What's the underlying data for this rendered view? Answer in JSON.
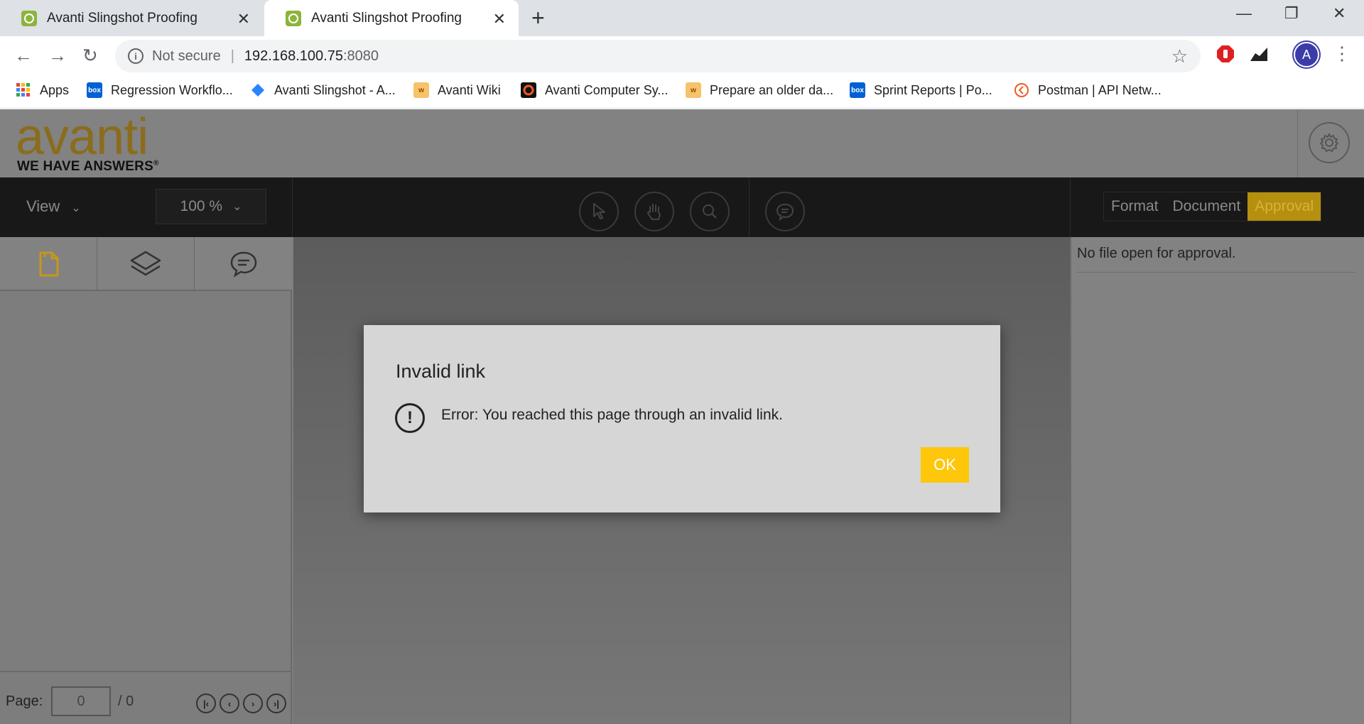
{
  "browser": {
    "tabs": [
      {
        "title": "Avanti Slingshot Proofing",
        "active": false
      },
      {
        "title": "Avanti Slingshot Proofing",
        "active": true
      }
    ],
    "new_tab_label": "+",
    "address": {
      "security": "Not secure",
      "host": "192.168.100.75",
      "port": ":8080"
    },
    "profile_initial": "A",
    "bookmarks": [
      {
        "label": "Apps",
        "icon": "apps-grid-icon"
      },
      {
        "label": "Regression Workflo...",
        "icon": "box-icon"
      },
      {
        "label": "Avanti Slingshot - A...",
        "icon": "jira-icon"
      },
      {
        "label": "Avanti Wiki",
        "icon": "wiki-icon"
      },
      {
        "label": "Avanti Computer Sy...",
        "icon": "avanti-o-icon"
      },
      {
        "label": "Prepare an older da...",
        "icon": "wiki-icon"
      },
      {
        "label": "Sprint Reports | Po...",
        "icon": "box-icon"
      },
      {
        "label": "Postman | API Netw...",
        "icon": "postman-icon"
      }
    ]
  },
  "app": {
    "logo_text": "avanti",
    "logo_tagline": "WE HAVE ANSWERS",
    "logo_reg": "®",
    "view_label": "View",
    "zoom_value": "100 %",
    "modes": [
      {
        "label": "Format",
        "active": false
      },
      {
        "label": "Document",
        "active": false
      },
      {
        "label": "Approval",
        "active": true
      }
    ],
    "right_panel_message": "No file open for approval.",
    "pager": {
      "label": "Page:",
      "current": "0",
      "total": "/ 0"
    }
  },
  "dialog": {
    "title": "Invalid link",
    "message": "Error: You reached this page through an invalid link.",
    "ok_label": "OK"
  },
  "colors": {
    "accent": "#fec70b",
    "logo": "#8a6c1c",
    "approval_active": "#b5900e"
  }
}
